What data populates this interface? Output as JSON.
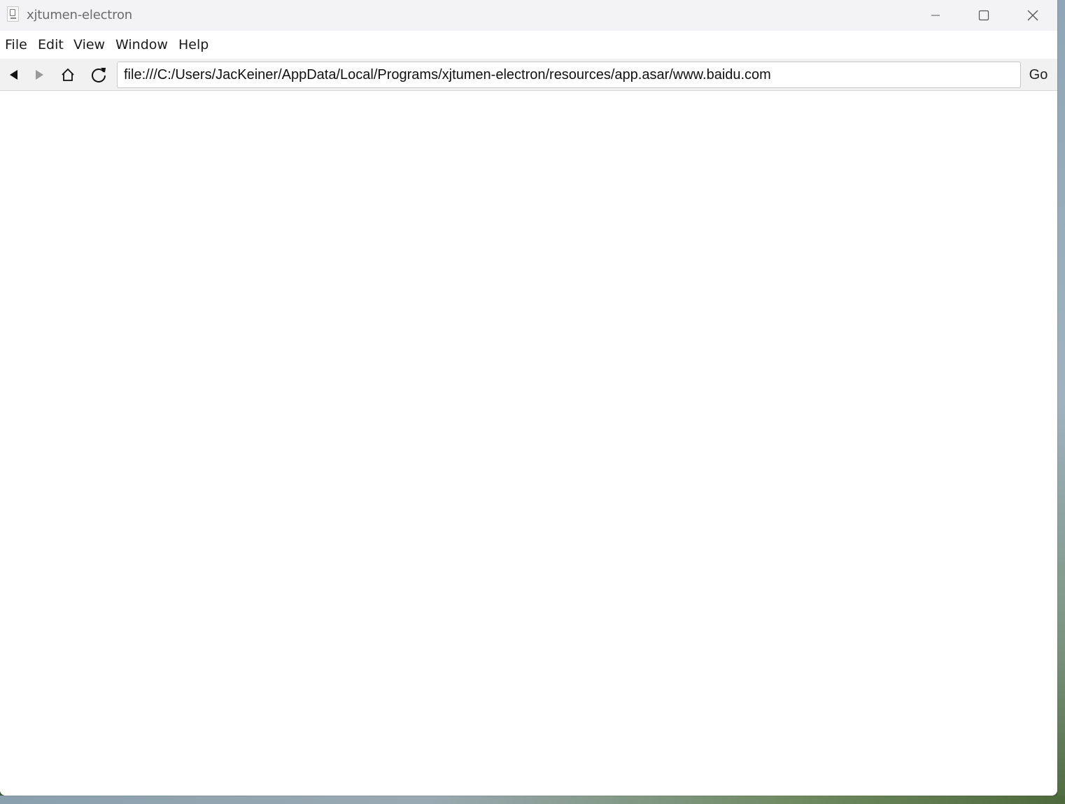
{
  "window": {
    "title": "xjtumen-electron",
    "icon": "app-document-icon",
    "controls": {
      "minimize_icon": "minimize-icon",
      "maximize_icon": "maximize-icon",
      "close_icon": "close-icon"
    }
  },
  "menu": {
    "items": [
      {
        "label": "File"
      },
      {
        "label": "Edit"
      },
      {
        "label": "View"
      },
      {
        "label": "Window"
      },
      {
        "label": "Help"
      }
    ]
  },
  "toolbar": {
    "back_icon": "back-arrow-icon",
    "forward_icon": "forward-arrow-icon",
    "home_icon": "home-icon",
    "reload_icon": "reload-icon",
    "url_value": "file:///C:/Users/JacKeiner/AppData/Local/Programs/xjtumen-electron/resources/app.asar/www.baidu.com",
    "go_label": "Go"
  },
  "colors": {
    "titlebar_bg": "#f3f2f4",
    "toolbar_bg": "#f1f1f1",
    "content_bg": "#ffffff",
    "forward_disabled": "#9a9a9a"
  }
}
